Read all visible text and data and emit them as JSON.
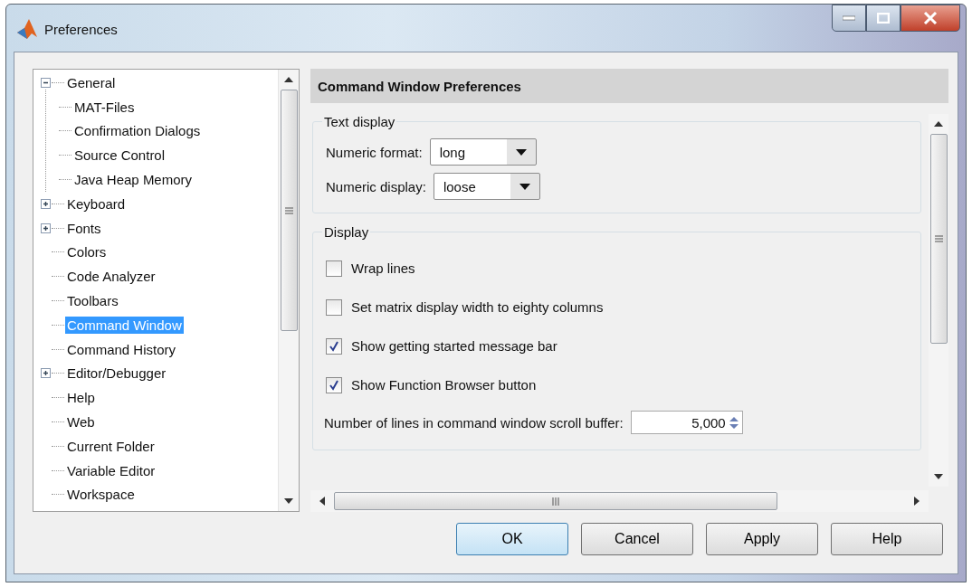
{
  "window": {
    "title": "Preferences"
  },
  "tree": [
    {
      "label": "General",
      "selected": false,
      "expanded": true,
      "children": [
        {
          "label": "MAT-Files",
          "selected": false
        },
        {
          "label": "Confirmation Dialogs",
          "selected": false
        },
        {
          "label": "Source Control",
          "selected": false
        },
        {
          "label": "Java Heap Memory",
          "selected": false
        }
      ]
    },
    {
      "label": "Keyboard",
      "selected": false,
      "expanded": false
    },
    {
      "label": "Fonts",
      "selected": false,
      "expanded": false
    },
    {
      "label": "Colors",
      "selected": false
    },
    {
      "label": "Code Analyzer",
      "selected": false
    },
    {
      "label": "Toolbars",
      "selected": false
    },
    {
      "label": "Command Window",
      "selected": true
    },
    {
      "label": "Command History",
      "selected": false
    },
    {
      "label": "Editor/Debugger",
      "selected": false,
      "expanded": false
    },
    {
      "label": "Help",
      "selected": false
    },
    {
      "label": "Web",
      "selected": false
    },
    {
      "label": "Current Folder",
      "selected": false
    },
    {
      "label": "Variable Editor",
      "selected": false
    },
    {
      "label": "Workspace",
      "selected": false
    }
  ],
  "panel": {
    "title": "Command Window Preferences"
  },
  "text_display": {
    "title": "Text display",
    "fields": [
      {
        "label": "Numeric format:",
        "value": "long"
      },
      {
        "label": "Numeric display:",
        "value": "loose"
      }
    ]
  },
  "display": {
    "title": "Display",
    "options": [
      {
        "label": "Wrap lines",
        "checked": false
      },
      {
        "label": "Set matrix display width to eighty columns",
        "checked": false
      },
      {
        "label": "Show getting started message bar",
        "checked": true
      },
      {
        "label": "Show Function Browser button",
        "checked": true
      }
    ],
    "buffer": {
      "label": "Number of lines in command window scroll buffer:",
      "value": "5,000"
    }
  },
  "buttons": [
    {
      "label": "OK",
      "focused": true
    },
    {
      "label": "Cancel",
      "focused": false
    },
    {
      "label": "Apply",
      "focused": false
    },
    {
      "label": "Help",
      "focused": false
    }
  ]
}
